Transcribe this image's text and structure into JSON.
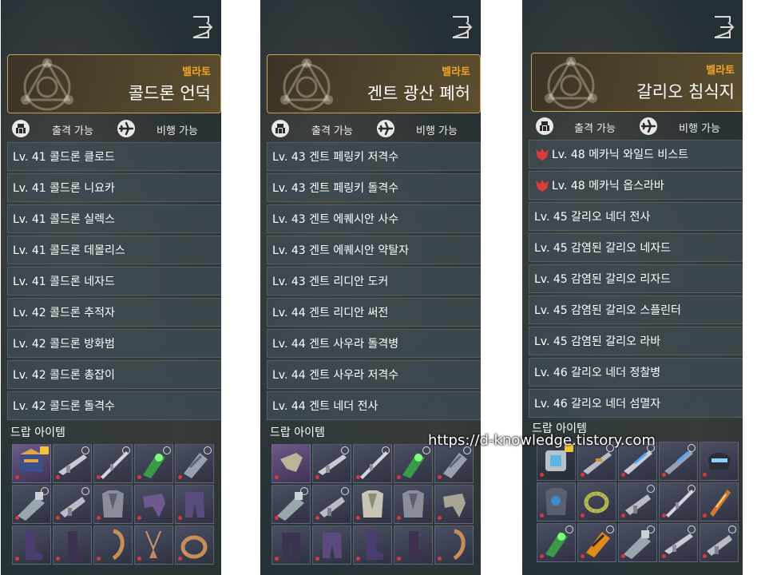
{
  "panels": [
    {
      "region": "벨라토",
      "zone": "콜드론 언덕",
      "status": {
        "deploy": "출격 가능",
        "flight": "비행 가능"
      },
      "monsters": [
        "Lv. 41 콜드론 클로드",
        "Lv. 41 콜드론 니요카",
        "Lv. 41 콜드론 실렉스",
        "Lv. 41 콜드론 데몰리스",
        "Lv. 41 콜드론 네자드",
        "Lv. 42 콜드론 추적자",
        "Lv. 42 콜드론 방화범",
        "Lv. 42 콜드론 총잡이",
        "Lv. 42 콜드론 돌격수"
      ],
      "drop_title": "드랍 아이템"
    },
    {
      "region": "벨라토",
      "zone": "겐트 광산 폐허",
      "status": {
        "deploy": "출격 가능",
        "flight": "비행 가능"
      },
      "monsters": [
        "Lv. 43 겐트 페링키 저격수",
        "Lv. 43 겐트 페링키 돌격수",
        "Lv. 43 겐트 에퀘시안 사수",
        "Lv. 43 겐트 에퀘시안 약탈자",
        "Lv. 43 겐트 리디안 도커",
        "Lv. 44 겐트 리디안 써전",
        "Lv. 44 겐트 사우라 돌격병",
        "Lv. 44 겐트 사우라 저격수",
        "Lv. 44 겐트 네더 전사"
      ],
      "drop_title": "드랍 아이템"
    },
    {
      "region": "벨라토",
      "zone": "갈리오 침식지",
      "status": {
        "deploy": "출격 가능",
        "flight": "비행 가능"
      },
      "monsters": [
        "Lv. 48 메카닉 와일드 비스트",
        "Lv. 48 메카닉 옵스라바",
        "Lv. 45 갈리오 네더 전사",
        "Lv. 45 감염된 갈리오 네자드",
        "Lv. 45 감염된 갈리오 리자드",
        "Lv. 45 감염된 갈리오 스플린터",
        "Lv. 45 감염된 갈리오 라바",
        "Lv. 46 갈리오 네더 정찰병",
        "Lv. 46 갈리오 네더 섬멸자"
      ],
      "drop_title": "드랍 아이템"
    }
  ],
  "watermark": "https://d-knowledge.tistory.com",
  "colors": {
    "region": "#f0a424",
    "header_border": "#c8a25a",
    "boss_icon": "#d83c3c",
    "rarity_dot": "#d43a3a"
  }
}
